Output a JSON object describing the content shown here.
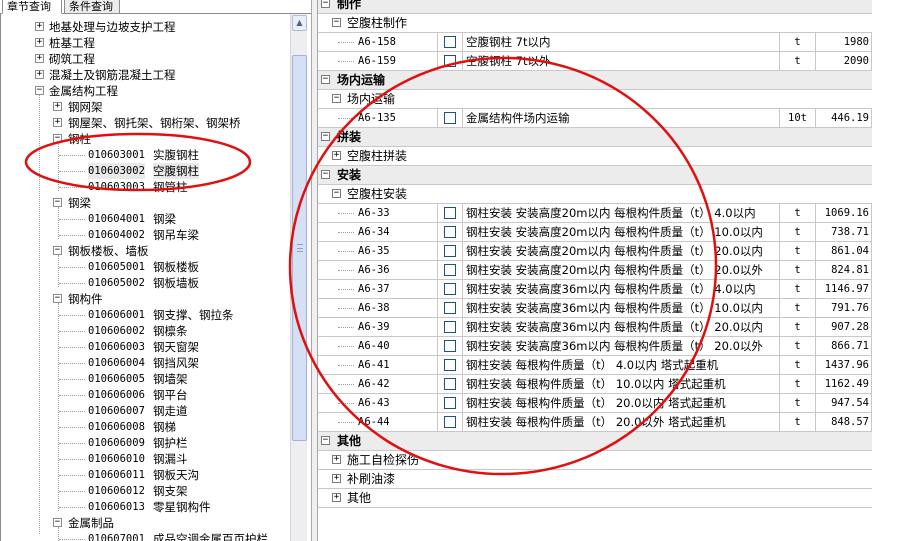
{
  "tabs": [
    {
      "label": "章节查询",
      "active": true
    },
    {
      "label": "条件查询",
      "active": false
    }
  ],
  "tree": [
    {
      "level": 1,
      "toggle": "+",
      "label": "地基处理与边坡支护工程"
    },
    {
      "level": 1,
      "toggle": "+",
      "label": "桩基工程"
    },
    {
      "level": 1,
      "toggle": "+",
      "label": "砌筑工程"
    },
    {
      "level": 1,
      "toggle": "+",
      "label": "混凝土及钢筋混凝土工程"
    },
    {
      "level": 1,
      "toggle": "-",
      "label": "金属结构工程"
    },
    {
      "level": 2,
      "toggle": "+",
      "label": "钢网架"
    },
    {
      "level": 2,
      "toggle": "+",
      "label": "钢屋架、钢托架、钢桁架、钢架桥"
    },
    {
      "level": 2,
      "toggle": "-",
      "label": "钢柱"
    },
    {
      "level": 3,
      "code": "010603001",
      "label": "实腹钢柱"
    },
    {
      "level": 3,
      "code": "010603002",
      "label": "空腹钢柱",
      "selected": true
    },
    {
      "level": 3,
      "code": "010603003",
      "label": "钢管柱"
    },
    {
      "level": 2,
      "toggle": "-",
      "label": "钢梁"
    },
    {
      "level": 3,
      "code": "010604001",
      "label": "钢梁"
    },
    {
      "level": 3,
      "code": "010604002",
      "label": "钢吊车梁"
    },
    {
      "level": 2,
      "toggle": "-",
      "label": "钢板楼板、墙板"
    },
    {
      "level": 3,
      "code": "010605001",
      "label": "钢板楼板"
    },
    {
      "level": 3,
      "code": "010605002",
      "label": "钢板墙板"
    },
    {
      "level": 2,
      "toggle": "-",
      "label": "钢构件"
    },
    {
      "level": 3,
      "code": "010606001",
      "label": "钢支撑、钢拉条"
    },
    {
      "level": 3,
      "code": "010606002",
      "label": "钢檩条"
    },
    {
      "level": 3,
      "code": "010606003",
      "label": "钢天窗架"
    },
    {
      "level": 3,
      "code": "010606004",
      "label": "钢挡风架"
    },
    {
      "level": 3,
      "code": "010606005",
      "label": "钢墙架"
    },
    {
      "level": 3,
      "code": "010606006",
      "label": "钢平台"
    },
    {
      "level": 3,
      "code": "010606007",
      "label": "钢走道"
    },
    {
      "level": 3,
      "code": "010606008",
      "label": "钢梯"
    },
    {
      "level": 3,
      "code": "010606009",
      "label": "钢护栏"
    },
    {
      "level": 3,
      "code": "010606010",
      "label": "钢漏斗"
    },
    {
      "level": 3,
      "code": "010606011",
      "label": "钢板天沟"
    },
    {
      "level": 3,
      "code": "010606012",
      "label": "钢支架"
    },
    {
      "level": 3,
      "code": "010606013",
      "label": "零星钢构件"
    },
    {
      "level": 2,
      "toggle": "-",
      "label": "金属制品"
    },
    {
      "level": 3,
      "code": "010607001",
      "label": "成品空调金属百页护栏"
    }
  ],
  "grid": [
    {
      "kind": "group",
      "toggle": "-",
      "label": "制作"
    },
    {
      "kind": "sub",
      "toggle": "-",
      "label": "空腹柱制作"
    },
    {
      "kind": "item",
      "code": "A6-158",
      "name": "空腹钢柱 7t以内",
      "unit": "t",
      "price": "1980"
    },
    {
      "kind": "item",
      "code": "A6-159",
      "name": "空腹钢柱 7t以外",
      "unit": "t",
      "price": "2090"
    },
    {
      "kind": "group",
      "toggle": "-",
      "label": "场内运输"
    },
    {
      "kind": "sub",
      "toggle": "-",
      "label": "场内运输"
    },
    {
      "kind": "item",
      "code": "A6-135",
      "name": "金属结构件场内运输",
      "unit": "10t",
      "price": "446.19"
    },
    {
      "kind": "group",
      "toggle": "-",
      "label": "拼装"
    },
    {
      "kind": "sub",
      "toggle": "+",
      "label": "空腹柱拼装"
    },
    {
      "kind": "group",
      "toggle": "-",
      "label": "安装"
    },
    {
      "kind": "sub",
      "toggle": "-",
      "label": "空腹柱安装"
    },
    {
      "kind": "item",
      "code": "A6-33",
      "name": "钢柱安装 安装高度20m以内 每根构件质量（t） 4.0以内",
      "unit": "t",
      "price": "1069.16"
    },
    {
      "kind": "item",
      "code": "A6-34",
      "name": "钢柱安装 安装高度20m以内 每根构件质量（t） 10.0以内",
      "unit": "t",
      "price": "738.71"
    },
    {
      "kind": "item",
      "code": "A6-35",
      "name": "钢柱安装 安装高度20m以内 每根构件质量（t） 20.0以内",
      "unit": "t",
      "price": "861.04"
    },
    {
      "kind": "item",
      "code": "A6-36",
      "name": "钢柱安装 安装高度20m以内 每根构件质量（t） 20.0以外",
      "unit": "t",
      "price": "824.81"
    },
    {
      "kind": "item",
      "code": "A6-37",
      "name": "钢柱安装 安装高度36m以内 每根构件质量（t） 4.0以内",
      "unit": "t",
      "price": "1146.97"
    },
    {
      "kind": "item",
      "code": "A6-38",
      "name": "钢柱安装 安装高度36m以内 每根构件质量（t） 10.0以内",
      "unit": "t",
      "price": "791.76"
    },
    {
      "kind": "item",
      "code": "A6-39",
      "name": "钢柱安装 安装高度36m以内 每根构件质量（t） 20.0以内",
      "unit": "t",
      "price": "907.28"
    },
    {
      "kind": "item",
      "code": "A6-40",
      "name": "钢柱安装 安装高度36m以内 每根构件质量（t） 20.0以外",
      "unit": "t",
      "price": "866.71"
    },
    {
      "kind": "item",
      "code": "A6-41",
      "name": "钢柱安装 每根构件质量（t） 4.0以内 塔式起重机",
      "unit": "t",
      "price": "1437.96"
    },
    {
      "kind": "item",
      "code": "A6-42",
      "name": "钢柱安装 每根构件质量（t） 10.0以内 塔式起重机",
      "unit": "t",
      "price": "1162.49"
    },
    {
      "kind": "item",
      "code": "A6-43",
      "name": "钢柱安装 每根构件质量（t） 20.0以内 塔式起重机",
      "unit": "t",
      "price": "947.54"
    },
    {
      "kind": "item",
      "code": "A6-44",
      "name": "钢柱安装 每根构件质量（t） 20.0以外 塔式起重机",
      "unit": "t",
      "price": "848.57"
    },
    {
      "kind": "group",
      "toggle": "-",
      "label": "其他"
    },
    {
      "kind": "sub",
      "toggle": "+",
      "label": "施工自检探伤"
    },
    {
      "kind": "sub",
      "toggle": "+",
      "label": "补刷油漆"
    },
    {
      "kind": "sub",
      "toggle": "+",
      "label": "其他"
    }
  ],
  "colors": {
    "annotation": "#e01010",
    "checkbox_border": "#1c5180",
    "group_bg": "#ececec",
    "scrollbar_thumb": "#d6e0f5"
  },
  "icons": {
    "expand": "plus-box-icon",
    "collapse": "minus-box-icon",
    "scroll_up": "arrow-up-icon"
  }
}
